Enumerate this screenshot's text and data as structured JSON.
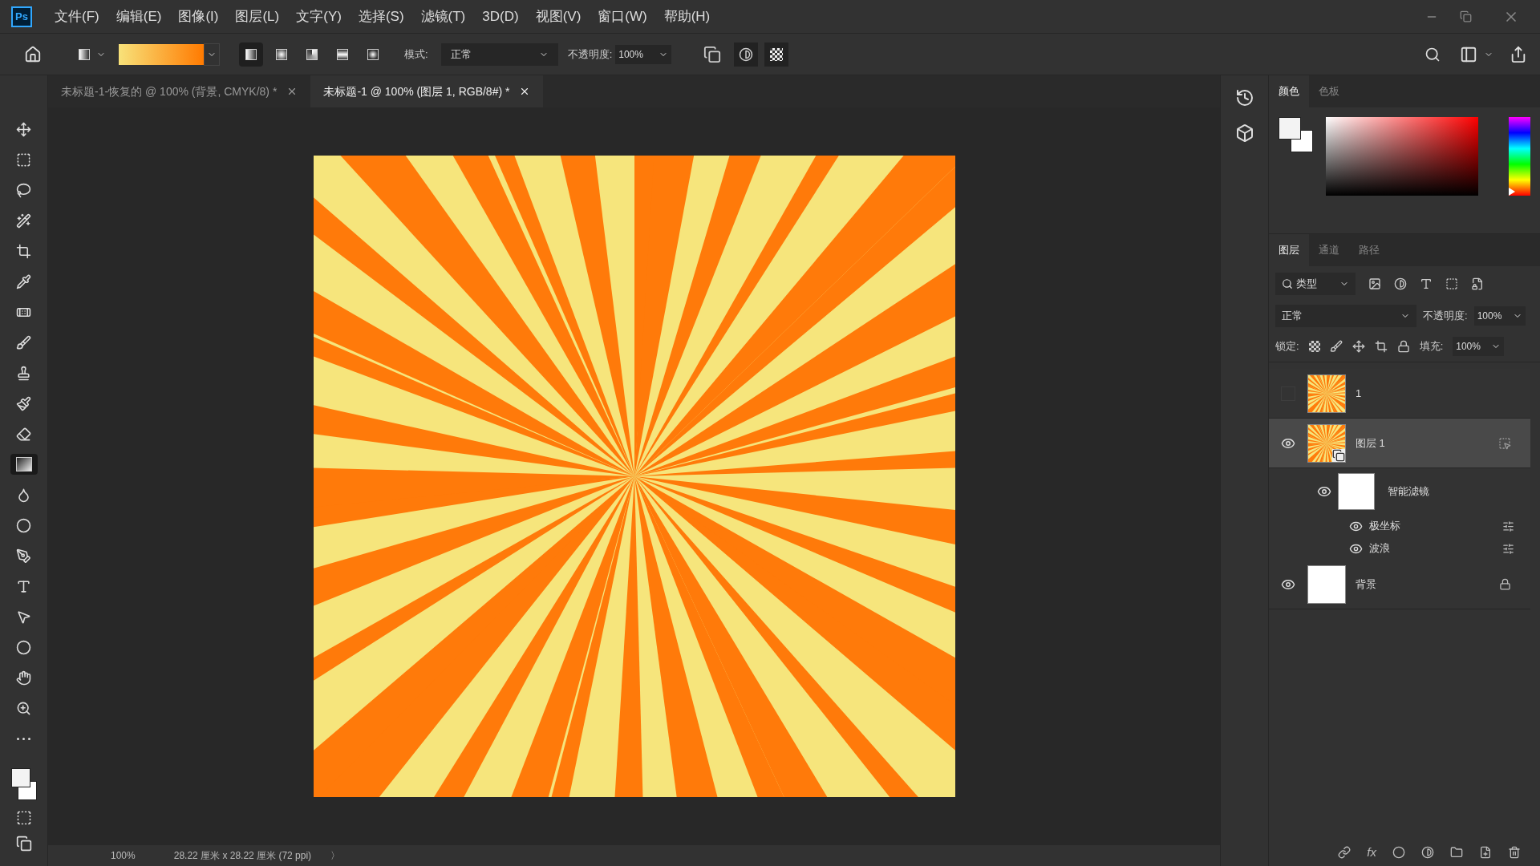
{
  "app_logo": "Ps",
  "menu": [
    "文件(F)",
    "编辑(E)",
    "图像(I)",
    "图层(L)",
    "文字(Y)",
    "选择(S)",
    "滤镜(T)",
    "3D(D)",
    "视图(V)",
    "窗口(W)",
    "帮助(H)"
  ],
  "options_bar": {
    "gradient_modes": [
      {
        "kind": "linear",
        "selected": true
      },
      {
        "kind": "radial",
        "selected": false
      },
      {
        "kind": "angle",
        "selected": false
      },
      {
        "kind": "reflected",
        "selected": false
      },
      {
        "kind": "diamond",
        "selected": false
      }
    ],
    "mode_label": "模式:",
    "mode_value": "正常",
    "opacity_label": "不透明度:",
    "opacity_value": "100%"
  },
  "document_tabs": [
    {
      "title": "未标题-1-恢复的 @ 100% (背景, CMYK/8) *",
      "selected": false
    },
    {
      "title": "未标题-1 @ 100% (图层 1, RGB/8#) *",
      "selected": true
    }
  ],
  "tools": [
    {
      "kind": "move",
      "selected": false
    },
    {
      "kind": "marquee",
      "selected": false
    },
    {
      "kind": "lasso",
      "selected": false
    },
    {
      "kind": "wand",
      "selected": false
    },
    {
      "kind": "crop",
      "selected": false
    },
    {
      "kind": "eyedropper",
      "selected": false
    },
    {
      "kind": "healing",
      "selected": false
    },
    {
      "kind": "brush",
      "selected": false
    },
    {
      "kind": "stamp",
      "selected": false
    },
    {
      "kind": "history",
      "selected": false
    },
    {
      "kind": "eraser",
      "selected": false
    },
    {
      "kind": "gradient",
      "selected": true
    },
    {
      "kind": "blur",
      "selected": false
    },
    {
      "kind": "dodge",
      "selected": false
    },
    {
      "kind": "pen",
      "selected": false
    },
    {
      "kind": "type",
      "selected": false
    },
    {
      "kind": "select",
      "selected": false
    },
    {
      "kind": "ellipse",
      "selected": false
    },
    {
      "kind": "hand",
      "selected": false
    },
    {
      "kind": "zoom",
      "selected": false
    },
    {
      "kind": "more",
      "selected": false
    }
  ],
  "color_panel": {
    "tabs": [
      {
        "label": "颜色",
        "selected": true
      },
      {
        "label": "色板",
        "selected": false
      }
    ],
    "hue_slider": {
      "level": 0
    }
  },
  "layers_panel": {
    "tabs": [
      {
        "label": "图层",
        "selected": true
      },
      {
        "label": "通道",
        "selected": false
      },
      {
        "label": "路径",
        "selected": false
      }
    ],
    "filter_label": "类型",
    "blend_mode": "正常",
    "opacity_label": "不透明度:",
    "opacity_value": "100%",
    "lock_label": "锁定:",
    "fill_label": "填充:",
    "fill_value": "100%",
    "fx_label": "fx",
    "layers": [
      {
        "kind": "layer",
        "name": "1",
        "visible": false,
        "selected": false,
        "smart_object": false,
        "locked": false
      },
      {
        "kind": "layer",
        "name": "图层 1",
        "visible": true,
        "selected": true,
        "smart_object": true,
        "locked": false,
        "children": [
          {
            "kind": "smart_filters",
            "name": "智能滤镜",
            "visible": true,
            "children": [
              {
                "kind": "filter",
                "name": "极坐标",
                "visible": true
              },
              {
                "kind": "filter",
                "name": "波浪",
                "visible": true
              }
            ]
          }
        ]
      },
      {
        "kind": "background",
        "name": "背景",
        "visible": true,
        "selected": false,
        "smart_object": false,
        "locked": true
      }
    ]
  },
  "status_bar": {
    "zoom": "100%",
    "doc_info": "28.22 厘米 x 28.22 厘米 (72 ppi)",
    "arrow": "〉"
  }
}
